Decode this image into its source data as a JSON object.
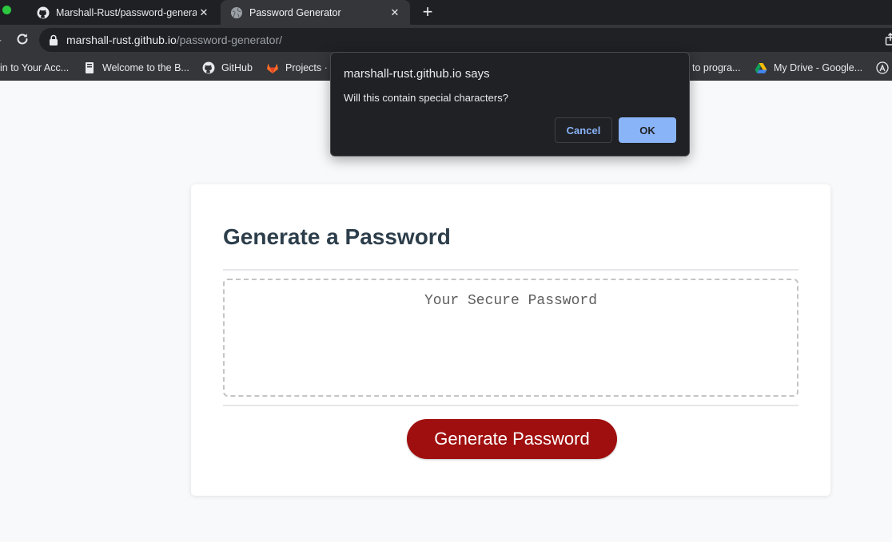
{
  "browser": {
    "tabs": [
      {
        "title": "Marshall-Rust/password-generator",
        "icon": "github-icon"
      },
      {
        "title": "Password Generator",
        "icon": "globe-icon"
      }
    ],
    "tab_close": "✕",
    "new_tab": "+",
    "url_host": "marshall-rust.github.io",
    "url_path": "/password-generator/",
    "bookmarks": [
      {
        "label": "in to Your Acc...",
        "icon": "none"
      },
      {
        "label": "Welcome to the B...",
        "icon": "book-icon"
      },
      {
        "label": "GitHub",
        "icon": "github-icon"
      },
      {
        "label": "Projects ·",
        "icon": "gitlab-icon"
      },
      {
        "label": "to progra...",
        "icon": "none"
      },
      {
        "label": "My Drive - Google...",
        "icon": "google-drive-icon"
      },
      {
        "label": "",
        "icon": "lambda-icon"
      }
    ]
  },
  "dialog": {
    "title": "marshall-rust.github.io says",
    "message": "Will this contain special characters?",
    "cancel_label": "Cancel",
    "ok_label": "OK"
  },
  "page": {
    "heading": "Generate a Password",
    "password_placeholder": "Your Secure Password",
    "generate_label": "Generate Password"
  },
  "colors": {
    "generate_button": "#a00f0f",
    "dialog_ok": "#8ab4f8",
    "heading": "#2d3e4b"
  }
}
